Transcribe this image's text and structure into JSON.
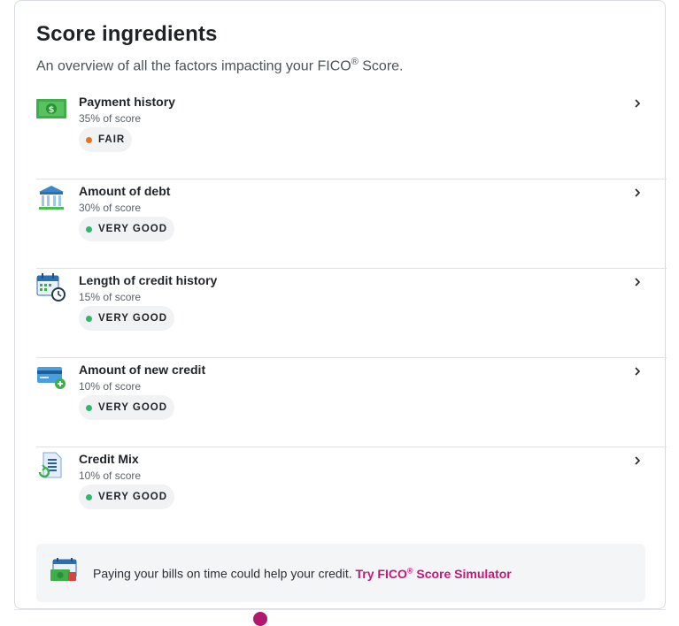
{
  "header": {
    "title": "Score ingredients",
    "subtitle_prefix": "An overview of all the factors impacting your FICO",
    "subtitle_reg": "®",
    "subtitle_suffix": " Score."
  },
  "colors": {
    "fair": "#e8731d",
    "very_good": "#2fb86a",
    "link": "#c2177b"
  },
  "factors": [
    {
      "name": "Payment history",
      "weight": "35% of score",
      "rating": "FAIR",
      "icon": "money-bill-icon"
    },
    {
      "name": "Amount of debt",
      "weight": "30% of score",
      "rating": "VERY GOOD",
      "icon": "bank-icon"
    },
    {
      "name": "Length of credit history",
      "weight": "15% of score",
      "rating": "VERY GOOD",
      "icon": "calendar-clock-icon"
    },
    {
      "name": "Amount of new credit",
      "weight": "10% of score",
      "rating": "VERY GOOD",
      "icon": "credit-card-plus-icon"
    },
    {
      "name": "Credit Mix",
      "weight": "10% of score",
      "rating": "VERY GOOD",
      "icon": "document-refresh-icon"
    }
  ],
  "tip": {
    "text": "Paying your bills on time could help your credit. ",
    "link_prefix": "Try FICO",
    "link_reg": "®",
    "link_suffix": " Score Simulator",
    "icon": "calendar-money-icon"
  }
}
